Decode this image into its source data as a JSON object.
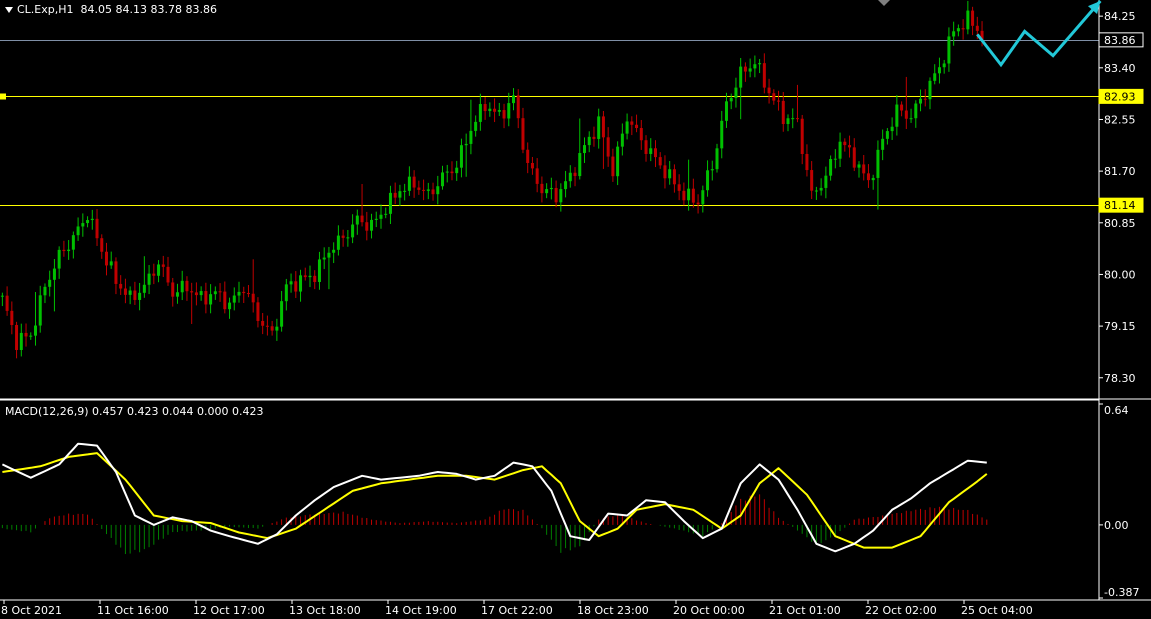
{
  "header": {
    "symbol": "CL.Exp,H1",
    "open": "84.05",
    "high": "84.13",
    "low": "83.78",
    "close": "83.86"
  },
  "macd_header": {
    "label": "MACD(12,26,9)",
    "values": "0.457 0.423 0.044 0.000 0.423"
  },
  "colors": {
    "background": "#000000",
    "bull_candle": "#00c000",
    "bear_candle": "#c00000",
    "level_line": "#ffff00",
    "current_price_line": "#7f8fa6",
    "macd_main": "#ffffff",
    "macd_signal": "#ffff00",
    "histogram_positive": "#c00000",
    "histogram_negative": "#008000",
    "forecast_arrow": "#22c8d8",
    "axis_text": "#ffffff",
    "price_tag_text": "#000000"
  },
  "chart_data": [
    {
      "type": "candlestick",
      "title": "CL.Exp,H1",
      "ylim": [
        78.0,
        84.45
      ],
      "y_ticks": [
        "84.25",
        "83.40",
        "82.55",
        "81.70",
        "80.85",
        "80.00",
        "79.15",
        "78.30"
      ],
      "x_ticks": [
        "8 Oct 2021",
        "11 Oct 16:00",
        "12 Oct 17:00",
        "13 Oct 18:00",
        "14 Oct 19:00",
        "17 Oct 22:00",
        "18 Oct 23:00",
        "20 Oct 00:00",
        "21 Oct 01:00",
        "22 Oct 02:00",
        "25 Oct 04:00"
      ],
      "current_price": "83.86",
      "horizontal_levels": [
        "82.93",
        "81.14"
      ],
      "path_points": [
        [
          0,
          79.6
        ],
        [
          3,
          78.9
        ],
        [
          6,
          79.0
        ],
        [
          9,
          79.8
        ],
        [
          12,
          80.3
        ],
        [
          15,
          80.6
        ],
        [
          18,
          81.0
        ],
        [
          21,
          80.4
        ],
        [
          24,
          79.9
        ],
        [
          27,
          79.6
        ],
        [
          30,
          79.8
        ],
        [
          33,
          80.2
        ],
        [
          36,
          79.7
        ],
        [
          39,
          79.8
        ],
        [
          42,
          79.6
        ],
        [
          45,
          79.7
        ],
        [
          48,
          79.5
        ],
        [
          51,
          79.8
        ],
        [
          54,
          79.3
        ],
        [
          57,
          79.0
        ],
        [
          60,
          79.8
        ],
        [
          63,
          79.9
        ],
        [
          66,
          80.0
        ],
        [
          69,
          80.4
        ],
        [
          72,
          80.6
        ],
        [
          75,
          80.9
        ],
        [
          78,
          80.8
        ],
        [
          81,
          81.1
        ],
        [
          84,
          81.4
        ],
        [
          87,
          81.5
        ],
        [
          90,
          81.3
        ],
        [
          93,
          81.6
        ],
        [
          96,
          81.8
        ],
        [
          99,
          82.4
        ],
        [
          102,
          82.8
        ],
        [
          105,
          82.6
        ],
        [
          108,
          82.9
        ],
        [
          111,
          81.8
        ],
        [
          114,
          81.4
        ],
        [
          117,
          81.3
        ],
        [
          120,
          81.6
        ],
        [
          123,
          82.1
        ],
        [
          126,
          82.5
        ],
        [
          129,
          81.7
        ],
        [
          132,
          82.6
        ],
        [
          135,
          82.2
        ],
        [
          138,
          81.9
        ],
        [
          141,
          81.6
        ],
        [
          144,
          81.3
        ],
        [
          147,
          81.2
        ],
        [
          150,
          81.8
        ],
        [
          153,
          82.8
        ],
        [
          156,
          83.3
        ],
        [
          159,
          83.5
        ],
        [
          162,
          83.0
        ],
        [
          165,
          82.6
        ],
        [
          168,
          82.5
        ],
        [
          171,
          81.3
        ],
        [
          174,
          81.6
        ],
        [
          177,
          82.2
        ],
        [
          180,
          81.9
        ],
        [
          183,
          81.5
        ],
        [
          186,
          82.2
        ],
        [
          189,
          82.7
        ],
        [
          192,
          82.6
        ],
        [
          195,
          83.0
        ],
        [
          198,
          83.4
        ],
        [
          201,
          84.0
        ],
        [
          204,
          84.2
        ],
        [
          206,
          84.05
        ],
        [
          207,
          83.86
        ]
      ],
      "forecast_arrow": [
        [
          206,
          83.95
        ],
        [
          211,
          83.45
        ],
        [
          216,
          84.0
        ],
        [
          222,
          83.6
        ],
        [
          232,
          84.5
        ]
      ]
    },
    {
      "type": "macd",
      "title": "MACD(12,26,9)",
      "ylim": [
        -0.387,
        0.64
      ],
      "y_ticks": [
        "0.64",
        "0.00",
        "-0.387"
      ],
      "main_points": [
        [
          0,
          0.32
        ],
        [
          6,
          0.25
        ],
        [
          12,
          0.32
        ],
        [
          16,
          0.43
        ],
        [
          20,
          0.42
        ],
        [
          24,
          0.28
        ],
        [
          28,
          0.05
        ],
        [
          32,
          0.0
        ],
        [
          36,
          0.04
        ],
        [
          40,
          0.02
        ],
        [
          44,
          -0.03
        ],
        [
          48,
          -0.06
        ],
        [
          54,
          -0.1
        ],
        [
          58,
          -0.05
        ],
        [
          62,
          0.05
        ],
        [
          66,
          0.13
        ],
        [
          70,
          0.2
        ],
        [
          76,
          0.26
        ],
        [
          80,
          0.24
        ],
        [
          84,
          0.25
        ],
        [
          88,
          0.26
        ],
        [
          92,
          0.28
        ],
        [
          96,
          0.27
        ],
        [
          100,
          0.24
        ],
        [
          104,
          0.26
        ],
        [
          108,
          0.33
        ],
        [
          112,
          0.31
        ],
        [
          116,
          0.18
        ],
        [
          120,
          -0.06
        ],
        [
          124,
          -0.08
        ],
        [
          128,
          0.06
        ],
        [
          132,
          0.05
        ],
        [
          136,
          0.13
        ],
        [
          140,
          0.12
        ],
        [
          144,
          0.02
        ],
        [
          148,
          -0.07
        ],
        [
          152,
          -0.02
        ],
        [
          156,
          0.22
        ],
        [
          160,
          0.32
        ],
        [
          164,
          0.24
        ],
        [
          168,
          0.08
        ],
        [
          172,
          -0.1
        ],
        [
          176,
          -0.14
        ],
        [
          180,
          -0.1
        ],
        [
          184,
          -0.03
        ],
        [
          188,
          0.08
        ],
        [
          192,
          0.14
        ],
        [
          196,
          0.22
        ],
        [
          200,
          0.28
        ],
        [
          204,
          0.34
        ],
        [
          208,
          0.33
        ]
      ],
      "signal_points": [
        [
          0,
          0.28
        ],
        [
          8,
          0.31
        ],
        [
          14,
          0.36
        ],
        [
          20,
          0.38
        ],
        [
          26,
          0.24
        ],
        [
          32,
          0.05
        ],
        [
          38,
          0.02
        ],
        [
          44,
          0.01
        ],
        [
          50,
          -0.04
        ],
        [
          56,
          -0.07
        ],
        [
          62,
          -0.02
        ],
        [
          68,
          0.08
        ],
        [
          74,
          0.18
        ],
        [
          80,
          0.22
        ],
        [
          86,
          0.24
        ],
        [
          92,
          0.26
        ],
        [
          98,
          0.26
        ],
        [
          104,
          0.24
        ],
        [
          110,
          0.29
        ],
        [
          114,
          0.31
        ],
        [
          118,
          0.22
        ],
        [
          122,
          0.02
        ],
        [
          126,
          -0.06
        ],
        [
          130,
          -0.02
        ],
        [
          134,
          0.08
        ],
        [
          140,
          0.11
        ],
        [
          146,
          0.08
        ],
        [
          152,
          -0.02
        ],
        [
          156,
          0.05
        ],
        [
          160,
          0.22
        ],
        [
          164,
          0.3
        ],
        [
          170,
          0.16
        ],
        [
          176,
          -0.06
        ],
        [
          182,
          -0.12
        ],
        [
          188,
          -0.12
        ],
        [
          194,
          -0.06
        ],
        [
          200,
          0.12
        ],
        [
          206,
          0.23
        ],
        [
          208,
          0.27
        ]
      ],
      "histogram_points": [
        [
          0,
          -0.02
        ],
        [
          6,
          -0.04
        ],
        [
          10,
          0.04
        ],
        [
          14,
          0.06
        ],
        [
          18,
          0.06
        ],
        [
          22,
          -0.05
        ],
        [
          26,
          -0.16
        ],
        [
          30,
          -0.14
        ],
        [
          36,
          -0.04
        ],
        [
          42,
          -0.03
        ],
        [
          48,
          -0.01
        ],
        [
          54,
          -0.02
        ],
        [
          60,
          0.04
        ],
        [
          66,
          0.06
        ],
        [
          72,
          0.07
        ],
        [
          78,
          0.03
        ],
        [
          84,
          0.01
        ],
        [
          90,
          0.02
        ],
        [
          96,
          0.01
        ],
        [
          102,
          0.03
        ],
        [
          106,
          0.09
        ],
        [
          110,
          0.08
        ],
        [
          114,
          -0.02
        ],
        [
          118,
          -0.15
        ],
        [
          122,
          -0.12
        ],
        [
          126,
          0.03
        ],
        [
          130,
          0.06
        ],
        [
          136,
          0.01
        ],
        [
          142,
          -0.02
        ],
        [
          148,
          -0.06
        ],
        [
          152,
          0.01
        ],
        [
          156,
          0.14
        ],
        [
          160,
          0.17
        ],
        [
          164,
          0.04
        ],
        [
          168,
          -0.03
        ],
        [
          172,
          -0.11
        ],
        [
          176,
          -0.06
        ],
        [
          180,
          0.03
        ],
        [
          186,
          0.05
        ],
        [
          192,
          0.08
        ],
        [
          198,
          0.1
        ],
        [
          204,
          0.08
        ],
        [
          208,
          0.03
        ]
      ]
    }
  ]
}
